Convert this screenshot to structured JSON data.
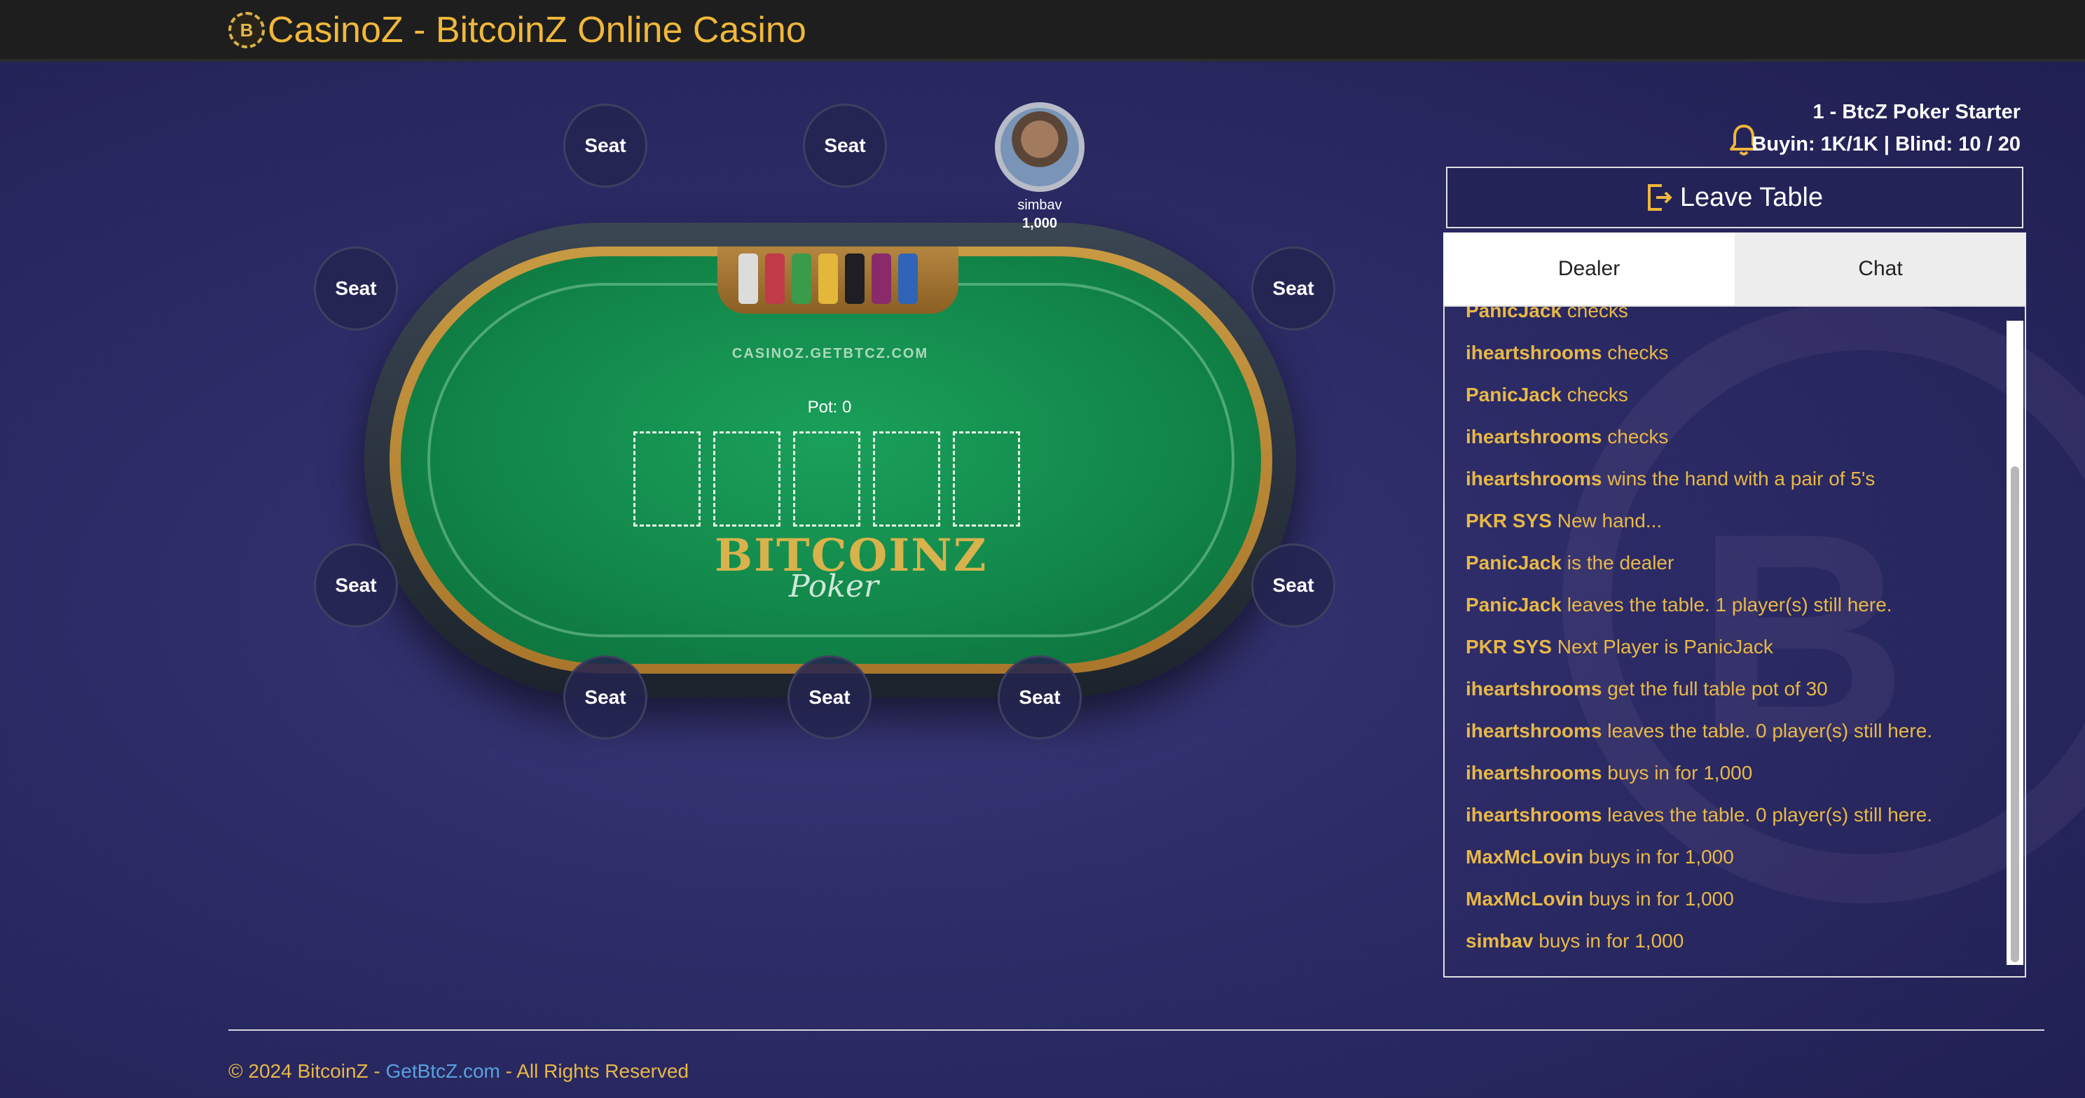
{
  "header": {
    "logo_letter": "B",
    "title": "CasinoZ - BitcoinZ Online Casino"
  },
  "table": {
    "felt_url": "CASINOZ.GETBTCZ.COM",
    "pot_label": "Pot: 0",
    "logo_text": "BITCOINZ",
    "logo_sub": "Poker",
    "seat_label": "Seat",
    "player": {
      "name": "simbav",
      "stack": "1,000"
    }
  },
  "info": {
    "table_name": "1 - BtcZ Poker Starter",
    "buyin": "Buyin: 1K/1K | Blind: 10 / 20"
  },
  "leave_button": {
    "label": "Leave Table"
  },
  "tabs": [
    {
      "label": "Dealer"
    },
    {
      "label": "Chat"
    }
  ],
  "log": [
    {
      "who": "PanicJack",
      "text": " checks"
    },
    {
      "who": "iheartshrooms",
      "text": " checks"
    },
    {
      "who": "PanicJack",
      "text": " checks"
    },
    {
      "who": "iheartshrooms",
      "text": " checks"
    },
    {
      "who": "iheartshrooms",
      "text": " wins the hand with a pair of 5's"
    },
    {
      "who": "PKR SYS",
      "text": " New hand..."
    },
    {
      "who": "PanicJack",
      "text": " is the dealer"
    },
    {
      "who": "PanicJack",
      "text": " leaves the table. 1 player(s) still here."
    },
    {
      "who": "PKR SYS",
      "text": " Next Player is PanicJack"
    },
    {
      "who": "iheartshrooms",
      "text": " get the full table pot of 30"
    },
    {
      "who": "iheartshrooms",
      "text": " leaves the table. 0 player(s) still here."
    },
    {
      "who": "iheartshrooms",
      "text": " buys in for 1,000"
    },
    {
      "who": "iheartshrooms",
      "text": " leaves the table. 0 player(s) still here."
    },
    {
      "who": "MaxMcLovin",
      "text": " buys in for 1,000"
    },
    {
      "who": "MaxMcLovin",
      "text": " buys in for 1,000"
    },
    {
      "who": "simbav",
      "text": " buys in for 1,000"
    }
  ],
  "footer": {
    "prefix": "© 2024 BitcoinZ - ",
    "link": "GetBtcZ.com",
    "suffix": " - All Rights Reserved"
  }
}
